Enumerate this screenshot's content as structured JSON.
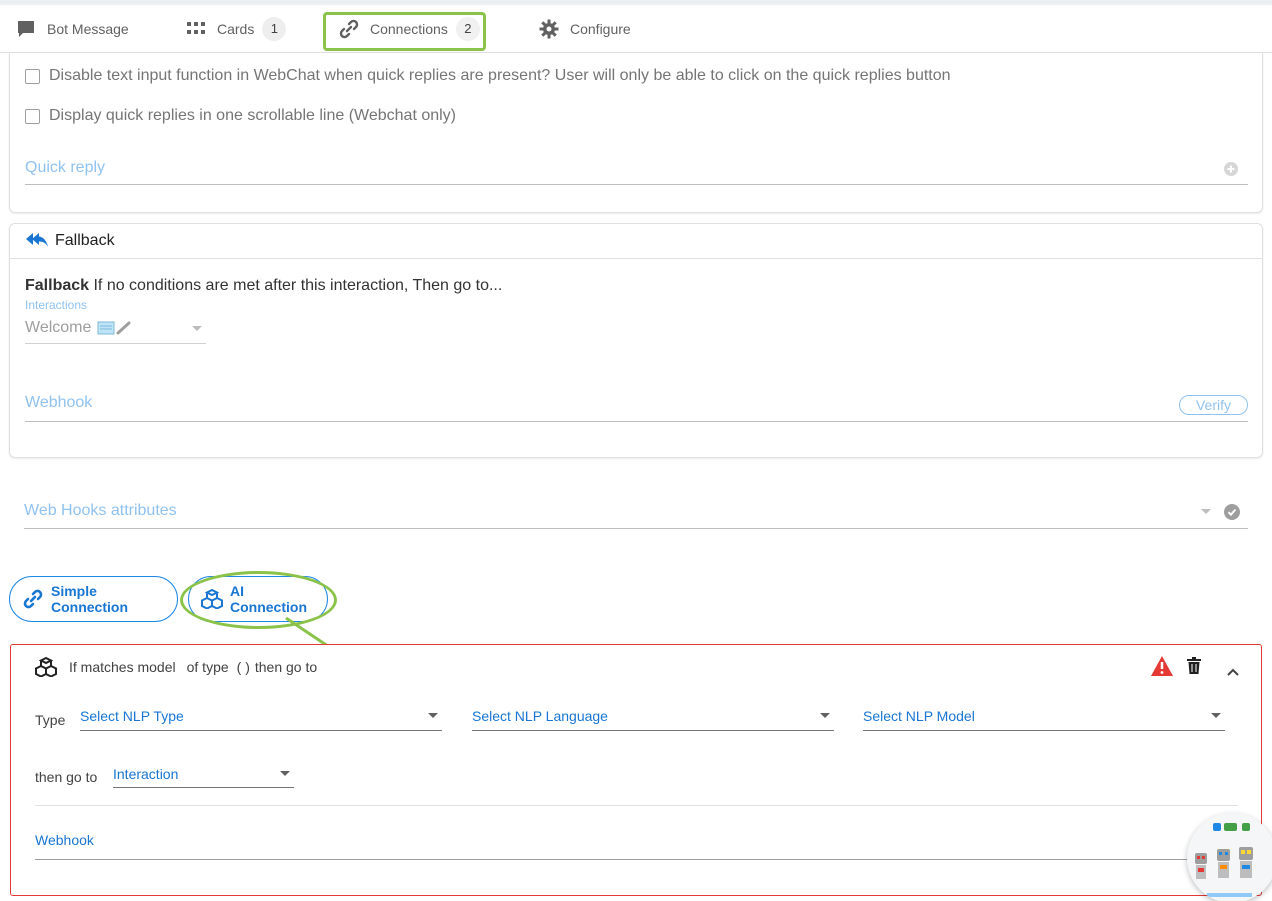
{
  "tabs": [
    {
      "label": "Bot Message",
      "icon": "chat-bubble-icon"
    },
    {
      "label": "Cards",
      "badge": "1",
      "icon": "grid-icon"
    },
    {
      "label": "Connections",
      "badge": "2",
      "icon": "link-icon",
      "active": true
    },
    {
      "label": "Configure",
      "icon": "gear-icon"
    }
  ],
  "quick_replies": {
    "disable_text_input_label": "Disable text input function in WebChat when quick replies are present?  User will only be able to click on the quick replies button",
    "scrollable_line_label": "Display quick replies in one scrollable line (Webchat only)",
    "quick_reply_placeholder": "Quick reply"
  },
  "fallback": {
    "header": "Fallback",
    "description_bold": "Fallback",
    "description": " If no conditions are met after this interaction, Then go to...",
    "interactions_label": "Interactions",
    "interactions_value": "Welcome",
    "webhook_placeholder": "Webhook",
    "verify_label": "Verify"
  },
  "webhook_attributes_placeholder": "Web Hooks attributes",
  "connection_buttons": {
    "simple": "Simple Connection",
    "ai": "AI Connection"
  },
  "ai_connection": {
    "header_prefix": "If matches model",
    "header_type": "of type",
    "header_parens": "( )",
    "header_suffix": "then go to",
    "type_label": "Type",
    "nlp_type": "Select NLP Type",
    "nlp_language": "Select NLP Language",
    "nlp_model": "Select NLP Model",
    "then_go_to_label": "then go to",
    "interaction_value": "Interaction",
    "webhook_placeholder": "Webhook"
  },
  "colors": {
    "accent": "#1976d2",
    "highlight": "#8bc34a",
    "error": "#e53935"
  }
}
